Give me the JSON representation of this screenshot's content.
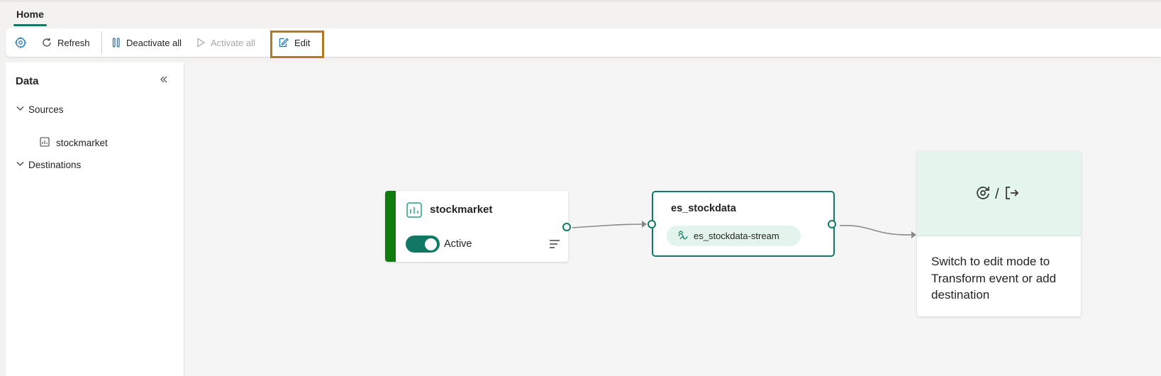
{
  "tabs": {
    "home": "Home"
  },
  "toolbar": {
    "settings_icon": "gear-icon",
    "refresh": "Refresh",
    "deactivate_all": "Deactivate all",
    "activate_all": "Activate all",
    "edit": "Edit",
    "accent_color": "#117865",
    "highlight_color": "#b57a1d"
  },
  "sidebar": {
    "title": "Data",
    "groups": [
      {
        "label": "Sources",
        "items": [
          {
            "label": "stockmarket",
            "icon": "chart-icon"
          }
        ]
      },
      {
        "label": "Destinations",
        "items": []
      }
    ]
  },
  "canvas": {
    "source": {
      "name": "stockmarket",
      "status": "Active",
      "accent": "#107c10"
    },
    "stream": {
      "name": "es_stockdata",
      "pill": "es_stockdata-stream"
    },
    "destination": {
      "message": "Switch to edit mode to Transform event or add destination",
      "icons": [
        "transform-icon",
        "exit-icon"
      ],
      "separator": "/"
    }
  }
}
